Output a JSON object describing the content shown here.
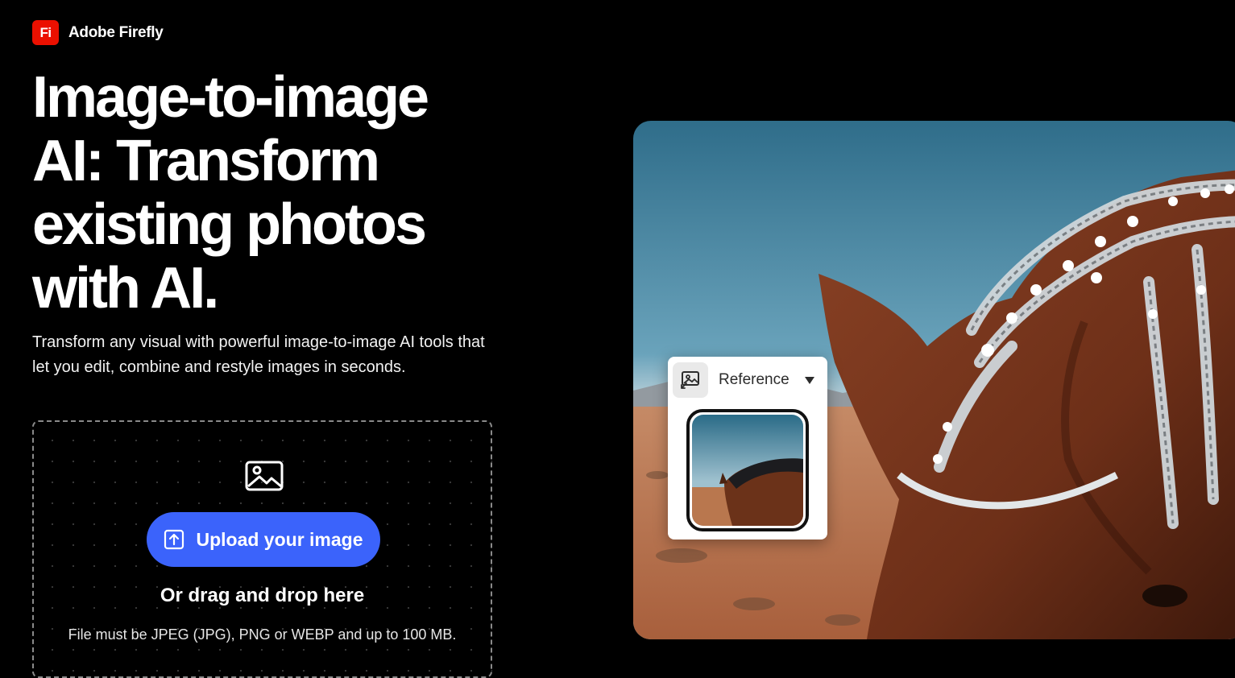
{
  "brand": {
    "logo_text": "Fi",
    "name": "Adobe Firefly",
    "logo_color": "#eb1000"
  },
  "hero": {
    "headline": "Image-to-image AI: Transform existing photos with AI.",
    "subtitle": "Transform any visual with powerful image-to-image AI tools that let you edit, combine and restyle images in seconds."
  },
  "dropzone": {
    "icon": "image-icon",
    "upload_icon": "upload-icon",
    "upload_label": "Upload your image",
    "or_text": "Or drag and drop here",
    "note": "File must be JPEG (JPG), PNG or WEBP and up to 100 MB.",
    "button_color": "#3b63fb"
  },
  "reference_card": {
    "icon": "reference-image-icon",
    "label": "Reference",
    "caret_icon": "caret-down-icon"
  }
}
